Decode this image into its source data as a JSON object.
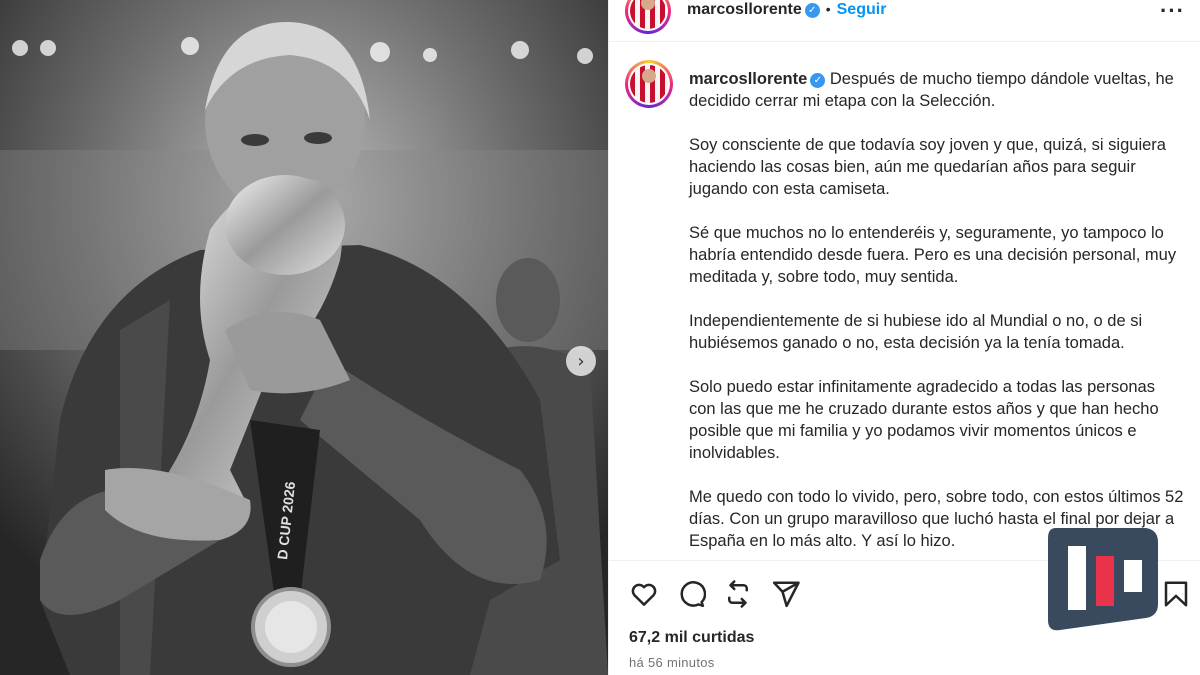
{
  "photo": {
    "trophy_medal_text": "D CUP 2026"
  },
  "header": {
    "username": "marcosllorente",
    "separator": "•",
    "follow_label": "Seguir",
    "more_label": "···"
  },
  "caption": {
    "username": "marcosllorente",
    "paragraphs": [
      "Después de mucho tiempo dándole vueltas, he decidido cerrar mi etapa con la Selección.",
      "Soy consciente de que todavía soy joven y que, quizá, si siguiera haciendo las cosas bien, aún me quedarían años para seguir jugando con esta camiseta.",
      "Sé que muchos no lo entenderéis y, seguramente, yo tampoco lo habría entendido desde fuera. Pero es una decisión personal, muy meditada y, sobre todo, muy sentida.",
      "Independientemente de si hubiese ido al Mundial o no, o de si hubiésemos ganado o no, esta decisión ya la tenía tomada.",
      "Solo puedo estar infinitamente agradecido a todas las personas con las que me he cruzado durante estos años y que han hecho posible que mi familia y yo podamos vivir momentos únicos e inolvidables.",
      "Me quedo con todo lo vivido, pero, sobre todo, con estos últimos 52 días. Con un grupo maravilloso que luchó hasta el final por dejar a España en lo más alto. Y así lo hizo."
    ]
  },
  "engagement": {
    "likes": "67,2 mil curtidas",
    "time": "há 56 minutos"
  },
  "icons": {
    "like": "heart-icon",
    "comment": "comment-icon",
    "share": "repost-icon",
    "send": "send-icon",
    "save": "bookmark-icon",
    "verified": "verified-badge-icon",
    "next": "chevron-right-icon"
  },
  "colors": {
    "follow": "#0095f6",
    "verified": "#3897f0",
    "logo_bg": "#3a4a5e",
    "logo_accent": "#e8334a"
  }
}
